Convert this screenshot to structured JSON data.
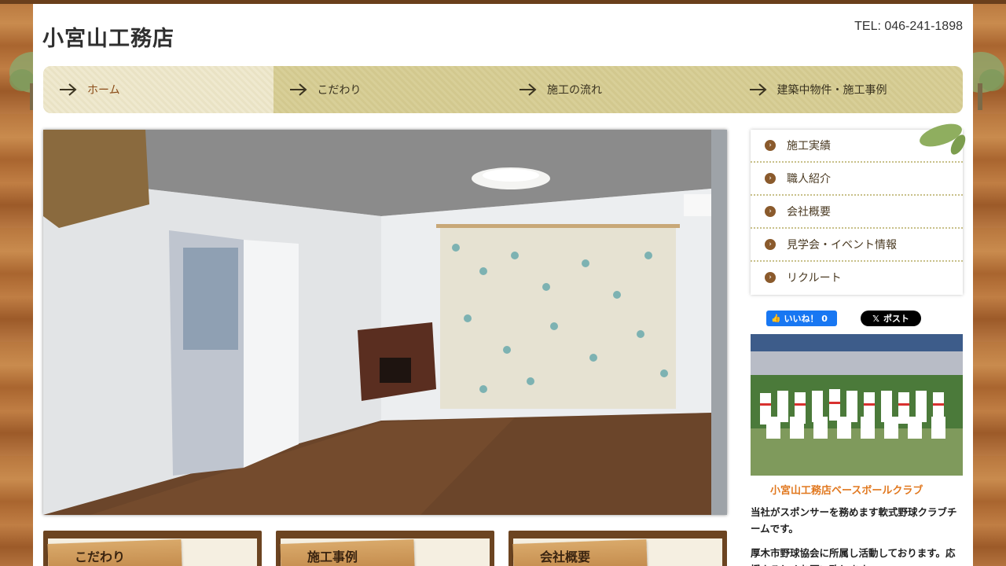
{
  "site": {
    "logo": "小宮山工務店",
    "tel": "TEL: 046-241-1898"
  },
  "global_nav": [
    {
      "label": "ホーム",
      "active": true
    },
    {
      "label": "こだわり",
      "active": false
    },
    {
      "label": "施工の流れ",
      "active": false
    },
    {
      "label": "建築中物件・施工事例",
      "active": false
    }
  ],
  "side_menu": [
    {
      "label": "施工実績",
      "icon": "arrow-circle-icon"
    },
    {
      "label": "職人紹介",
      "icon": "arrow-circle-icon"
    },
    {
      "label": "会社概要",
      "icon": "arrow-circle-icon"
    },
    {
      "label": "見学会・イベント情報",
      "icon": "arrow-circle-icon"
    },
    {
      "label": "リクルート",
      "icon": "arrow-circle-icon"
    }
  ],
  "social": {
    "fb_like_label": "いいね！ 0",
    "x_post_label": "ポスト"
  },
  "club": {
    "title": "小宮山工務店ベースボールクラブ",
    "text1": "当社がスポンサーを務めます軟式野球クラブチームです。",
    "text2": "厚木市野球協会に所属し活動しております。応援よろしくお願い致します。"
  },
  "banners": [
    {
      "label": "こだわり"
    },
    {
      "label": "施工事例"
    },
    {
      "label": "会社概要"
    }
  ],
  "colors": {
    "accent": "#8a4b17",
    "club_title": "#e1781f",
    "nav_bg": "#d8cf98"
  }
}
